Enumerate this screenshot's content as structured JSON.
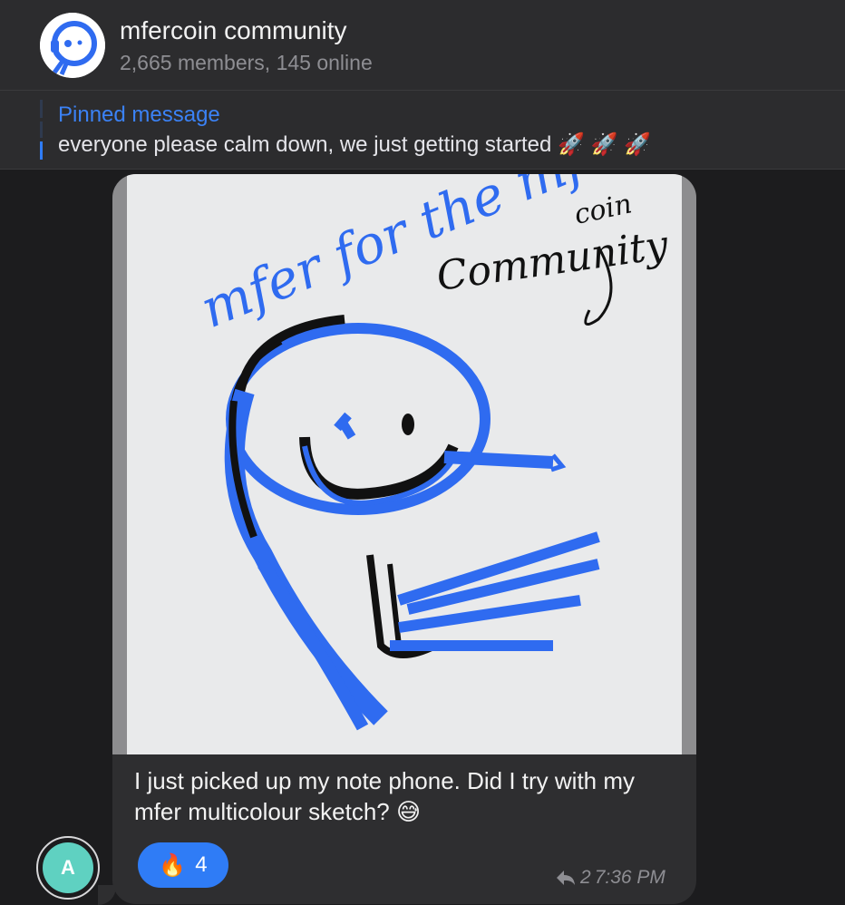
{
  "header": {
    "title": "mfercoin community",
    "subtitle": "2,665 members, 145 online",
    "avatar_icon": "mfer-headset-logo-icon"
  },
  "pinned": {
    "title": "Pinned message",
    "text": "everyone please calm down, we just getting started",
    "emoji": "🚀 🚀 🚀"
  },
  "message": {
    "image": {
      "handwriting_line1": "mfer for the mfer",
      "handwriting_line2": "coin",
      "handwriting_line3": "Community"
    },
    "caption": "I just picked up my note phone. Did I try with my mfer multicolour sketch?",
    "caption_emoji": "😅",
    "reaction": {
      "emoji": "🔥",
      "count": "4"
    },
    "replies": "2",
    "time": "7:36 PM",
    "sender_initial": "A"
  },
  "colors": {
    "accent": "#2f7cf6",
    "avatar_bg": "#5fd1c1",
    "ink_blue": "#2f6bf0",
    "ink_black": "#111111"
  }
}
